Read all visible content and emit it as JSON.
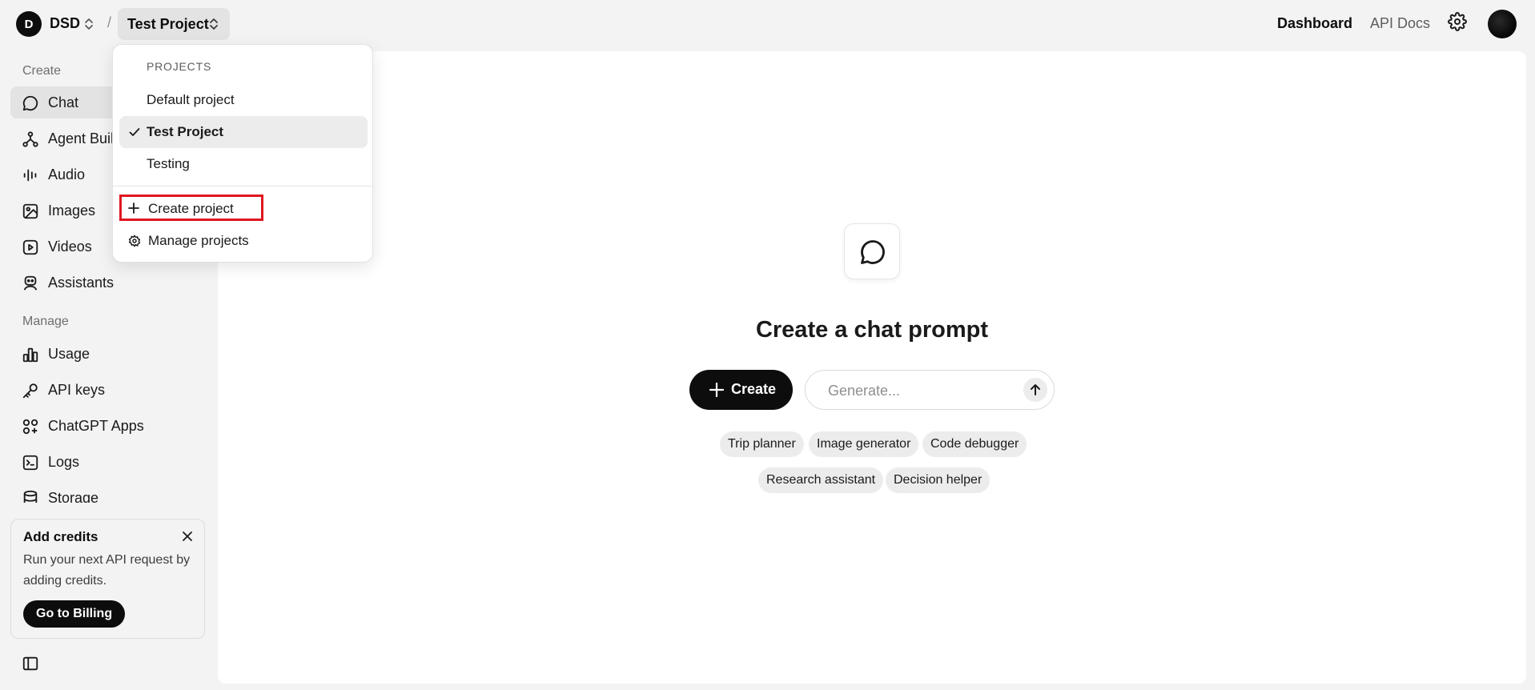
{
  "topbar": {
    "org_initial": "D",
    "org_name": "DSD",
    "separator": "/",
    "project_name": "Test Project",
    "nav": {
      "dashboard": "Dashboard",
      "api_docs": "API Docs"
    }
  },
  "sidebar": {
    "create_label": "Create",
    "create_items": [
      {
        "label": "Chat",
        "icon": "chat-bubble-icon",
        "active": true
      },
      {
        "label": "Agent Builder",
        "icon": "agent-builder-icon"
      },
      {
        "label": "Audio",
        "icon": "audio-waveform-icon"
      },
      {
        "label": "Images",
        "icon": "image-icon"
      },
      {
        "label": "Videos",
        "icon": "video-icon"
      },
      {
        "label": "Assistants",
        "icon": "robot-icon"
      }
    ],
    "manage_label": "Manage",
    "manage_items": [
      {
        "label": "Usage",
        "icon": "bar-chart-icon"
      },
      {
        "label": "API keys",
        "icon": "key-icon"
      },
      {
        "label": "ChatGPT Apps",
        "icon": "apps-grid-icon"
      },
      {
        "label": "Logs",
        "icon": "terminal-icon"
      },
      {
        "label": "Storage",
        "icon": "database-icon"
      }
    ],
    "credits": {
      "title": "Add credits",
      "text": "Run your next API request by adding credits.",
      "button": "Go to Billing"
    }
  },
  "main": {
    "title": "Create a chat prompt",
    "create_button": "Create",
    "generate_placeholder": "Generate...",
    "chips": [
      "Trip planner",
      "Image generator",
      "Code debugger",
      "Research assistant",
      "Decision helper"
    ]
  },
  "dropdown": {
    "header": "PROJECTS",
    "projects": [
      {
        "label": "Default project",
        "selected": false
      },
      {
        "label": "Test Project",
        "selected": true
      },
      {
        "label": "Testing",
        "selected": false
      }
    ],
    "create_project": "Create project",
    "manage_projects": "Manage projects",
    "highlight_color": "#e0161f"
  },
  "colors": {
    "accent": "#0d0d0d",
    "page_bg": "#f3f3f3",
    "panel_bg": "#ffffff"
  }
}
